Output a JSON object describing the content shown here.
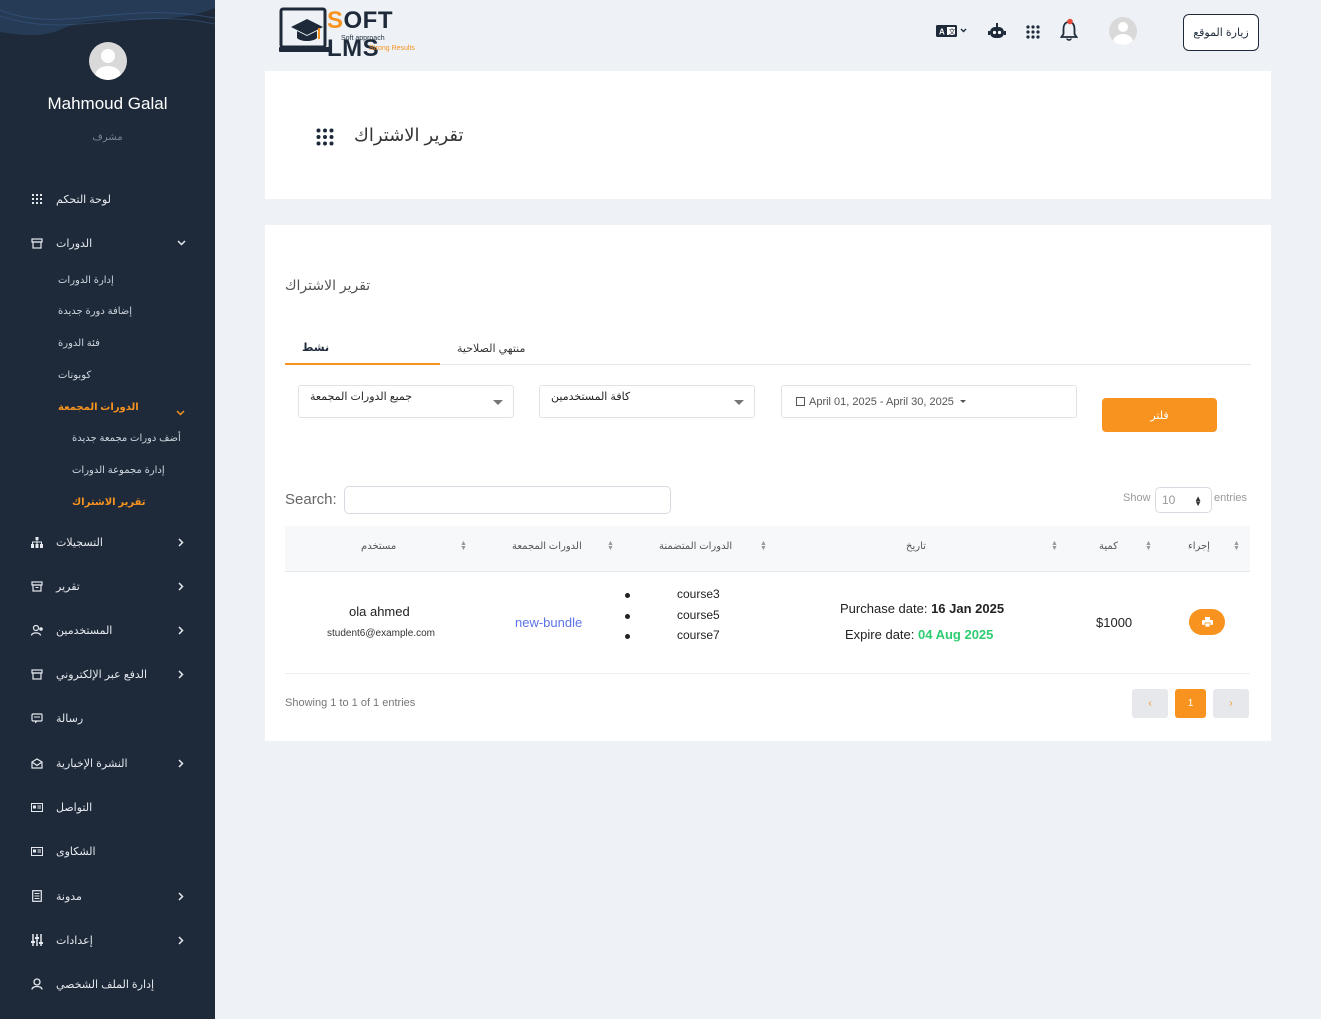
{
  "sidebar": {
    "user_name": "Mahmoud Galal",
    "user_role": "مشرف",
    "items": [
      {
        "label": "لوحة التحكم",
        "icon": "grid-icon"
      },
      {
        "label": "الدورات",
        "icon": "courses-icon"
      },
      {
        "label": "التسجيلات",
        "icon": "sitemap-icon"
      },
      {
        "label": "تقرير",
        "icon": "archive-icon"
      },
      {
        "label": "المستخدمين",
        "icon": "users-icon"
      },
      {
        "label": "الدفع عبر الإلكتروني",
        "icon": "payment-icon"
      },
      {
        "label": "رسالة",
        "icon": "message-icon"
      },
      {
        "label": "النشرة الإخبارية",
        "icon": "newsletter-icon"
      },
      {
        "label": "التواصل",
        "icon": "contact-icon"
      },
      {
        "label": "الشكاوى",
        "icon": "complaints-icon"
      },
      {
        "label": "مدونة",
        "icon": "blog-icon"
      },
      {
        "label": "إعدادات",
        "icon": "settings-icon"
      },
      {
        "label": "إدارة الملف الشخصي",
        "icon": "profile-icon"
      }
    ],
    "courses_sub": [
      "إدارة الدورات",
      "إضافة دورة جديدة",
      "فئة الدورة",
      "كوبونات",
      "الدورات المجمعة"
    ],
    "bundle_sub": [
      "أضف دورات مجمعة جديدة",
      "إدارة مجموعة الدورات",
      "تقرير الاشتراك"
    ]
  },
  "header": {
    "logo_text_s": "S",
    "logo_text_rest": "OFT LMS",
    "logo_tag1": "Soft approach",
    "logo_tag2": "Strong Results",
    "visit_label": "زيارة الموقع"
  },
  "page": {
    "title": "تقرير الاشتراك",
    "subtitle": "تقرير الاشتراك",
    "tabs": [
      {
        "label": "نشط",
        "active": true
      },
      {
        "label": "منتهي الصلاحية",
        "active": false
      }
    ],
    "filters": {
      "bundle_select": "جميع الدورات المجمعة",
      "user_select": "كافة المستخدمين",
      "date_range": "April 01, 2025 - April 30, 2025",
      "filter_button": "فلتر"
    },
    "table": {
      "search_label": "Search:",
      "show_label": "Show",
      "show_value": "10",
      "entries_label": "entries",
      "columns": [
        "مستخدم",
        "الدورات المجمعة",
        "الدورات المتضمنة",
        "تاريخ",
        "كمية",
        "إجراء"
      ],
      "rows": [
        {
          "user_name": "ola ahmed",
          "user_email": "student6@example.com",
          "bundle": "new-bundle",
          "courses": [
            "course3",
            "course5",
            "course7"
          ],
          "purchase_label": "Purchase date:",
          "purchase_date": "16 Jan 2025",
          "expire_label": "Expire date:",
          "expire_date": "04 Aug 2025",
          "amount": "$1000"
        }
      ],
      "showing": "Showing 1 to 1 of 1 entries",
      "pagination": {
        "prev": "‹",
        "current": "1",
        "next": "›"
      }
    }
  },
  "colors": {
    "accent": "#f7931e",
    "sidebar": "#1e2a3a",
    "link": "#5b73e8",
    "success": "#2ecc71"
  }
}
